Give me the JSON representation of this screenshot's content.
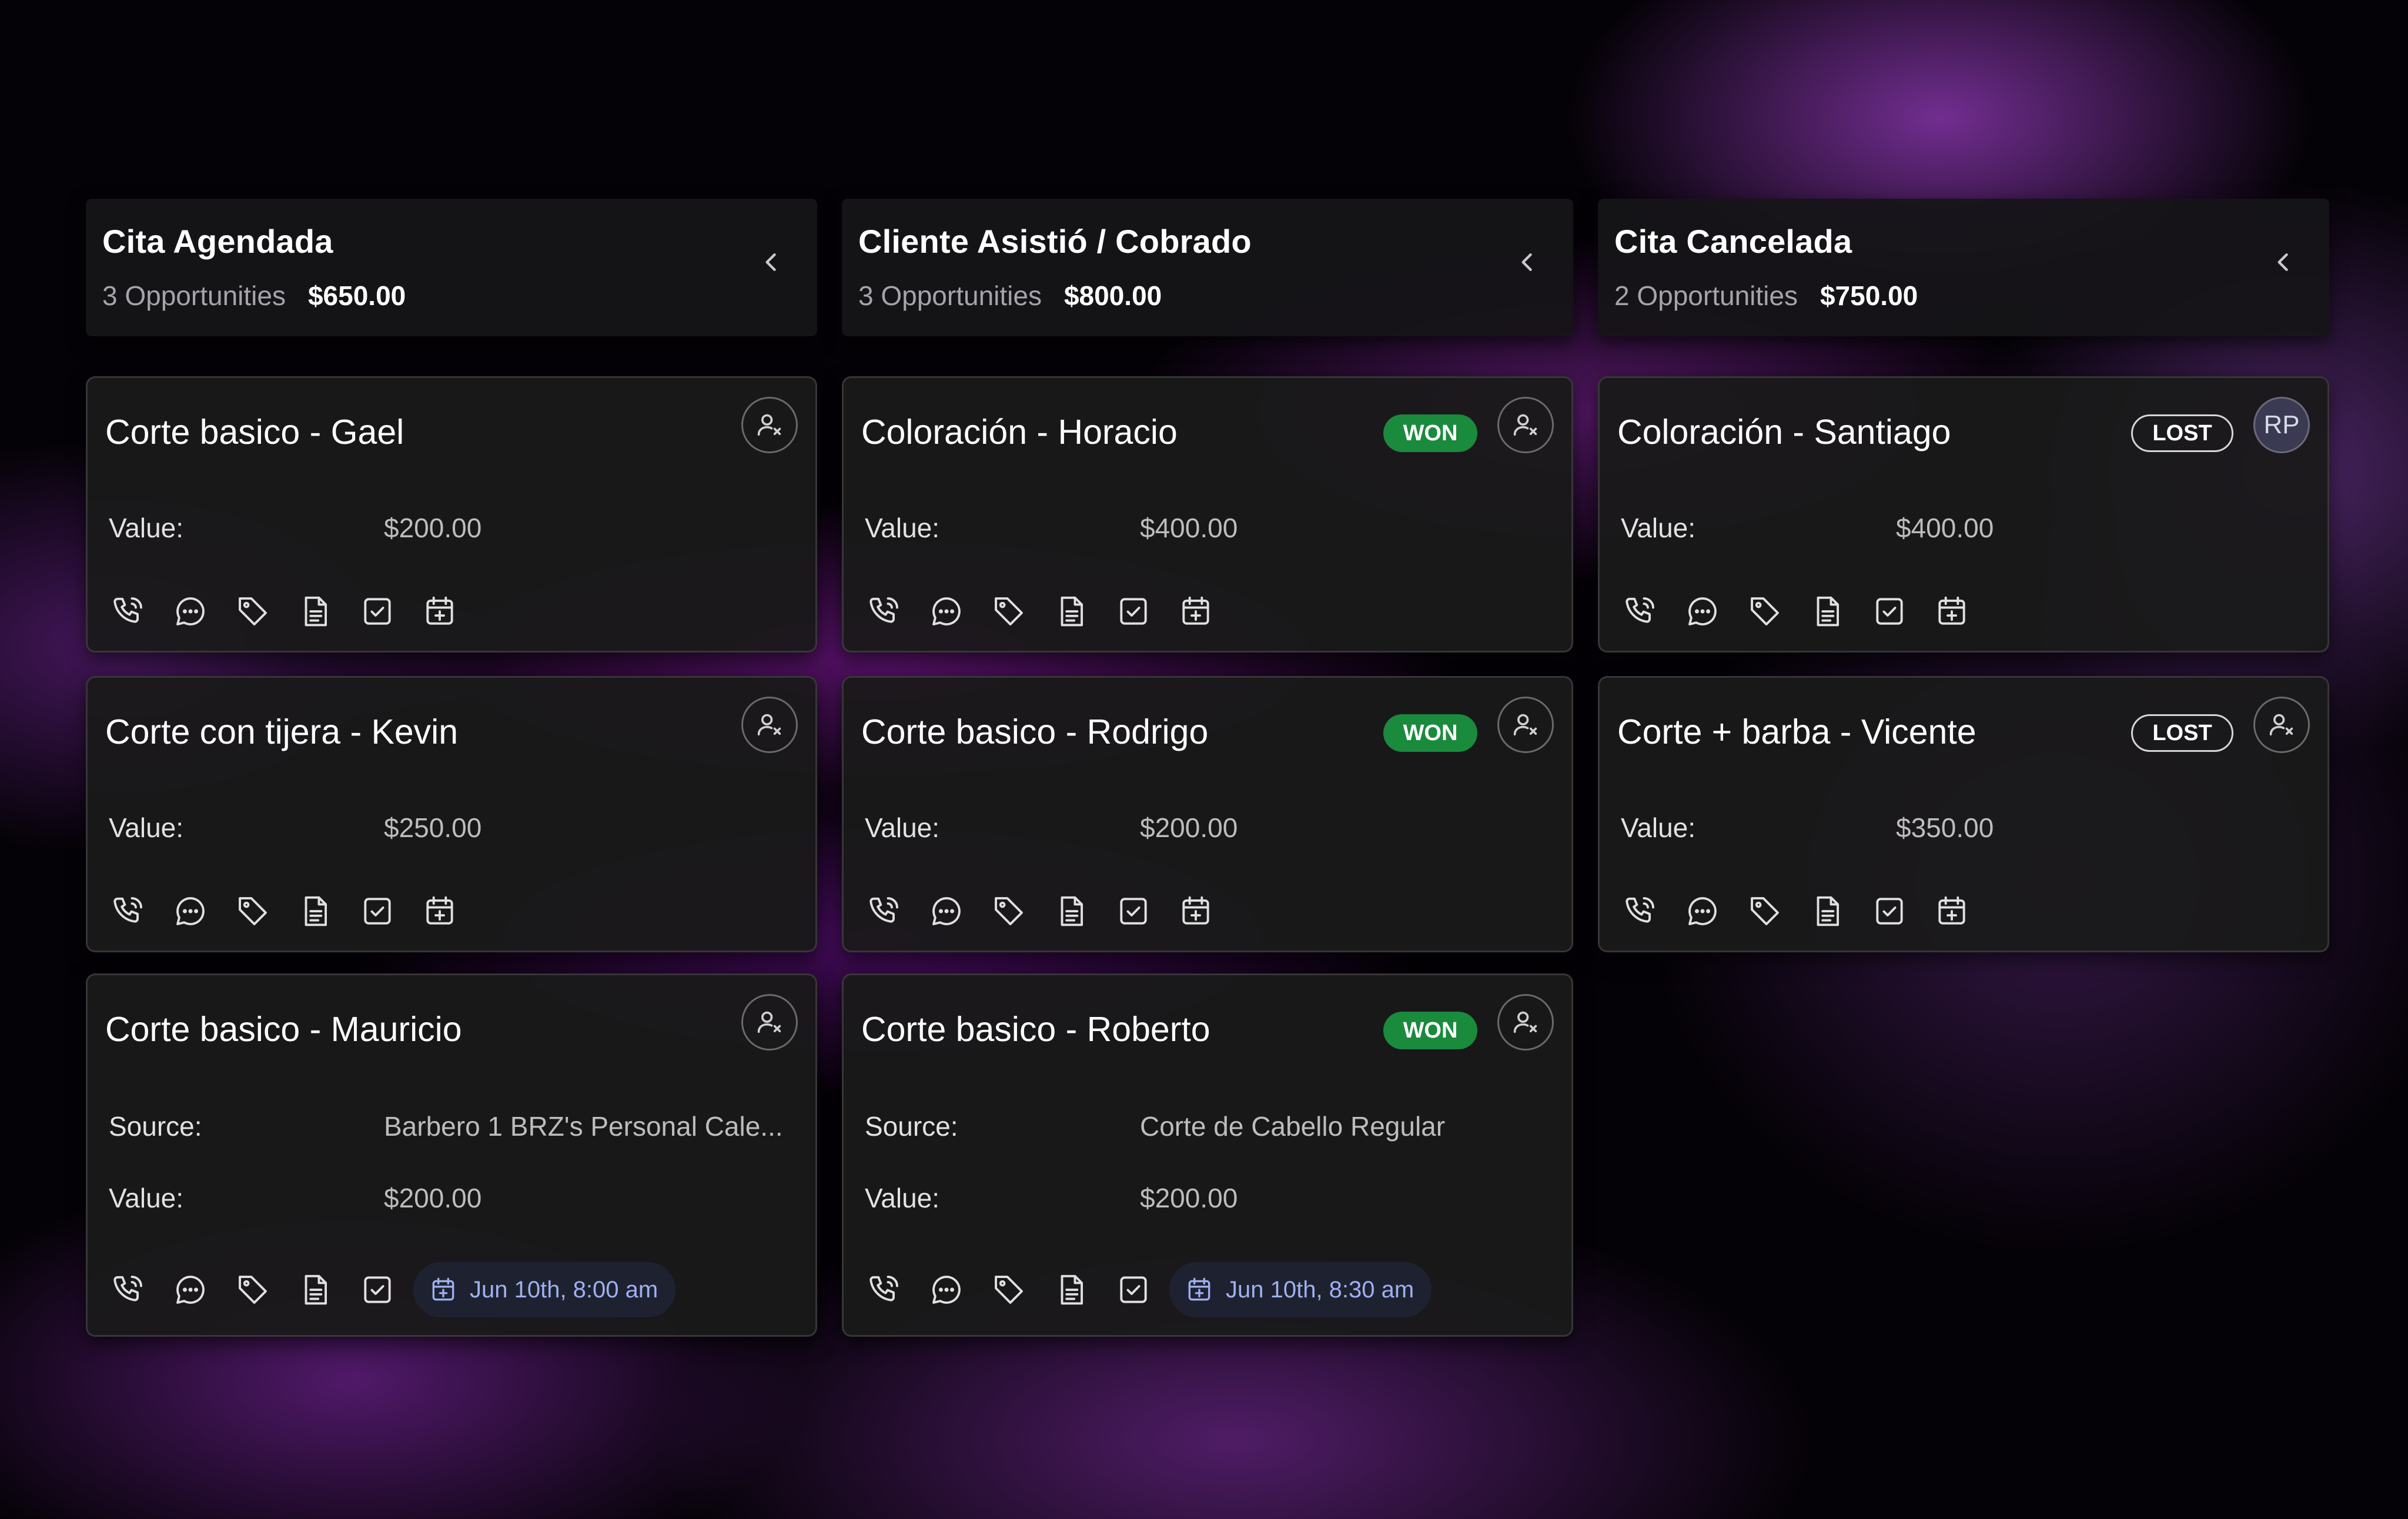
{
  "columns": [
    {
      "title": "Cita Agendada",
      "count": "3 Opportunities",
      "total": "$650.00",
      "cards": [
        {
          "title": "Corte basico - Gael",
          "value_label": "Value:",
          "value": "$200.00"
        },
        {
          "title": "Corte con tijera - Kevin",
          "value_label": "Value:",
          "value": "$250.00"
        },
        {
          "title": "Corte basico - Mauricio",
          "source_label": "Source:",
          "source": "Barbero 1 BRZ's Personal Cale...",
          "value_label": "Value:",
          "value": "$200.00",
          "appointment": "Jun 10th, 8:00 am"
        }
      ]
    },
    {
      "title": "Cliente Asistió / Cobrado",
      "count": "3 Opportunities",
      "total": "$800.00",
      "cards": [
        {
          "title": "Coloración - Horacio",
          "status": "WON",
          "value_label": "Value:",
          "value": "$400.00"
        },
        {
          "title": "Corte basico - Rodrigo",
          "status": "WON",
          "value_label": "Value:",
          "value": "$200.00"
        },
        {
          "title": "Corte basico - Roberto",
          "status": "WON",
          "source_label": "Source:",
          "source": "Corte de Cabello Regular",
          "value_label": "Value:",
          "value": "$200.00",
          "appointment": "Jun 10th, 8:30 am"
        }
      ]
    },
    {
      "title": "Cita Cancelada",
      "count": "2 Opportunities",
      "total": "$750.00",
      "cards": [
        {
          "title": "Coloración - Santiago",
          "status": "LOST",
          "owner_initials": "RP",
          "value_label": "Value:",
          "value": "$400.00"
        },
        {
          "title": "Corte + barba - Vicente",
          "status": "LOST",
          "value_label": "Value:",
          "value": "$350.00"
        }
      ]
    }
  ],
  "icons": {
    "collapse": "chevron-left-icon",
    "assign": "user-unassigned-icon",
    "actions": [
      "phone-icon",
      "chat-icon",
      "tag-icon",
      "note-icon",
      "task-icon",
      "calendar-add-icon"
    ]
  },
  "colors": {
    "won": "#1a8a3d",
    "appointment_text": "#9fb0f0",
    "appointment_bg": "#1e2230"
  }
}
